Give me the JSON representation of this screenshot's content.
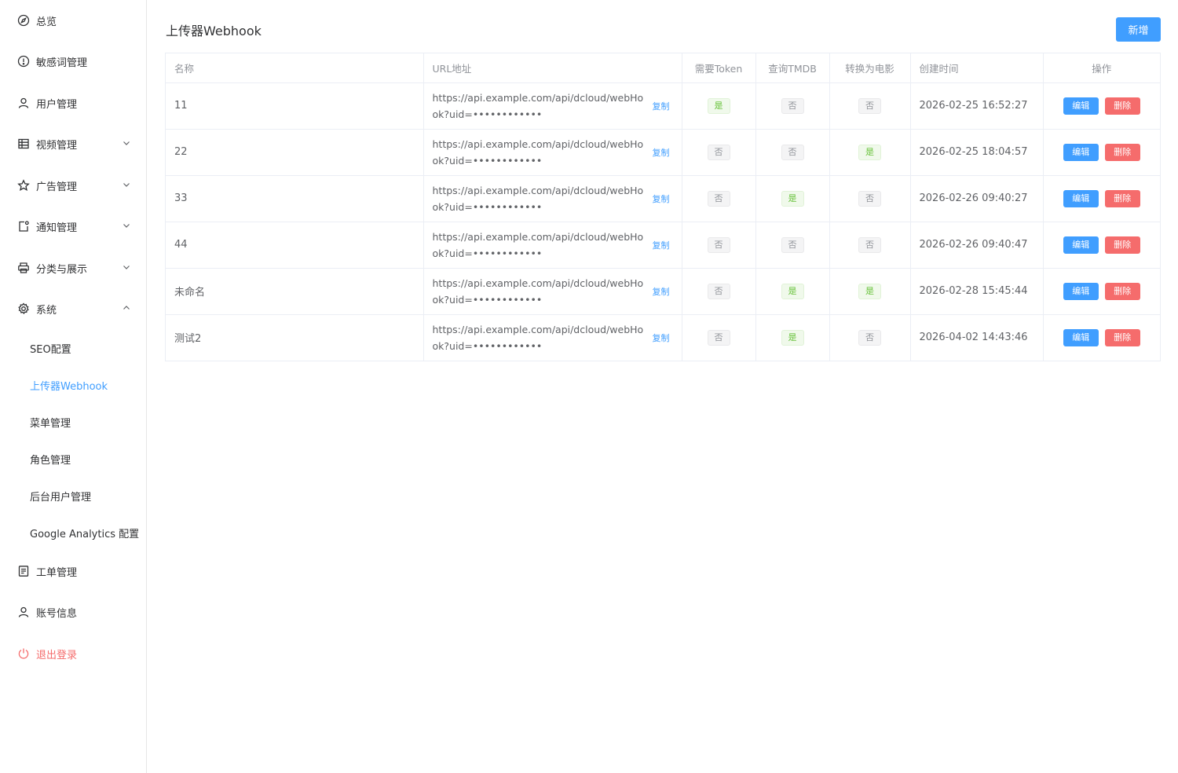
{
  "sidebar": {
    "menu": [
      {
        "label": "总览",
        "icon": "compass-icon"
      },
      {
        "label": "敏感词管理",
        "icon": "alert-circle-icon"
      },
      {
        "label": "用户管理",
        "icon": "user-icon"
      },
      {
        "label": "视频管理",
        "icon": "grid-icon",
        "expandable": true
      },
      {
        "label": "广告管理",
        "icon": "star-icon",
        "expandable": true
      },
      {
        "label": "通知管理",
        "icon": "bell-icon",
        "expandable": true
      },
      {
        "label": "分类与展示",
        "icon": "printer-icon",
        "expandable": true
      },
      {
        "label": "系统",
        "icon": "gear-icon",
        "expanded": true
      }
    ],
    "system_submenu": [
      {
        "label": "SEO配置"
      },
      {
        "label": "上传器Webhook",
        "active": true
      },
      {
        "label": "菜单管理"
      },
      {
        "label": "角色管理"
      },
      {
        "label": "后台用户管理"
      },
      {
        "label": "Google Analytics 配置"
      }
    ],
    "bottom_menu": [
      {
        "label": "工单管理",
        "icon": "document-icon"
      },
      {
        "label": "账号信息",
        "icon": "user-icon"
      },
      {
        "label": "退出登录",
        "icon": "power-icon"
      }
    ]
  },
  "page": {
    "title": "上传器Webhook",
    "add_label": "新增"
  },
  "table": {
    "headers": {
      "name": "名称",
      "url": "URL地址",
      "need_token": "需要Token",
      "query_tmdb": "查询TMDB",
      "to_movie": "转换为电影",
      "created": "创建时间",
      "ops": "操作"
    },
    "copy_label": "复制",
    "edit_label": "编辑",
    "delete_label": "删除",
    "yes": "是",
    "no": "否",
    "rows": [
      {
        "name": "11",
        "url": "https://api.example.com/api/dcloud/webHook?uid=••••••••••••",
        "need_token": true,
        "query_tmdb": false,
        "to_movie": false,
        "created": "2026-02-25 16:52:27"
      },
      {
        "name": "22",
        "url": "https://api.example.com/api/dcloud/webHook?uid=••••••••••••",
        "need_token": false,
        "query_tmdb": false,
        "to_movie": true,
        "created": "2026-02-25 18:04:57"
      },
      {
        "name": "33",
        "url": "https://api.example.com/api/dcloud/webHook?uid=••••••••••••",
        "need_token": false,
        "query_tmdb": true,
        "to_movie": false,
        "created": "2026-02-26 09:40:27"
      },
      {
        "name": "44",
        "url": "https://api.example.com/api/dcloud/webHook?uid=••••••••••••",
        "need_token": false,
        "query_tmdb": false,
        "to_movie": false,
        "created": "2026-02-26 09:40:47"
      },
      {
        "name": "未命名",
        "url": "https://api.example.com/api/dcloud/webHook?uid=••••••••••••",
        "need_token": false,
        "query_tmdb": true,
        "to_movie": true,
        "created": "2026-02-28 15:45:44"
      },
      {
        "name": "测试2",
        "url": "https://api.example.com/api/dcloud/webHook?uid=••••••••••••",
        "need_token": false,
        "query_tmdb": true,
        "to_movie": false,
        "created": "2026-04-02 14:43:46"
      }
    ]
  },
  "colors": {
    "primary": "#409eff",
    "danger": "#f56c6c",
    "success": "#67c23a"
  }
}
